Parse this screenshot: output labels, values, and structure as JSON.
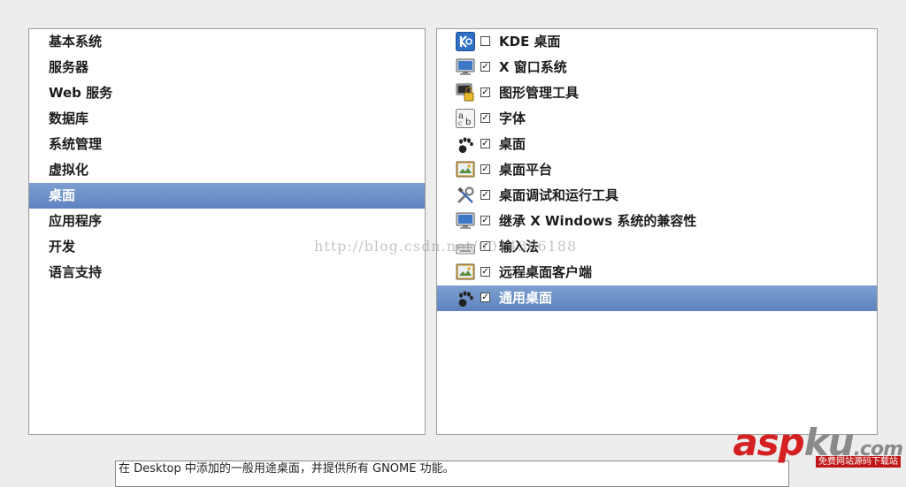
{
  "categories": [
    {
      "label": "基本系统",
      "selected": false
    },
    {
      "label": "服务器",
      "selected": false
    },
    {
      "label": "Web 服务",
      "selected": false
    },
    {
      "label": "数据库",
      "selected": false
    },
    {
      "label": "系统管理",
      "selected": false
    },
    {
      "label": "虚拟化",
      "selected": false
    },
    {
      "label": "桌面",
      "selected": true
    },
    {
      "label": "应用程序",
      "selected": false
    },
    {
      "label": "开发",
      "selected": false
    },
    {
      "label": "语言支持",
      "selected": false
    }
  ],
  "groups": [
    {
      "label": "KDE 桌面",
      "checked": false,
      "icon": "kde-icon",
      "selected": false
    },
    {
      "label": "X 窗口系统",
      "checked": true,
      "icon": "monitor-icon",
      "selected": false
    },
    {
      "label": "图形管理工具",
      "checked": true,
      "icon": "admin-lock-monitor-icon",
      "selected": false
    },
    {
      "label": "字体",
      "checked": true,
      "icon": "font-icon",
      "selected": false
    },
    {
      "label": "桌面",
      "checked": true,
      "icon": "gnome-foot-icon",
      "selected": false
    },
    {
      "label": "桌面平台",
      "checked": true,
      "icon": "desktop-picture-icon",
      "selected": false
    },
    {
      "label": "桌面调试和运行工具",
      "checked": true,
      "icon": "tools-icon",
      "selected": false
    },
    {
      "label": "继承 X Windows 系统的兼容性",
      "checked": true,
      "icon": "monitor-icon",
      "selected": false
    },
    {
      "label": "输入法",
      "checked": true,
      "icon": "keyboard-icon",
      "selected": false
    },
    {
      "label": "远程桌面客户端",
      "checked": true,
      "icon": "desktop-picture-icon",
      "selected": false
    },
    {
      "label": "通用桌面",
      "checked": true,
      "icon": "gnome-foot-icon",
      "selected": true
    }
  ],
  "watermark": "http://blog.csdn.net/u014366188",
  "description": "在 Desktop 中添加的一般用途桌面，并提供所有 GNOME 功能。",
  "logo": {
    "main_red": "asp",
    "main_gray": "ku",
    "suffix": ".com",
    "subtitle": "免费网站源码下载站"
  },
  "colors": {
    "selection": "#6b8ec6",
    "logo_red": "#d42020"
  }
}
